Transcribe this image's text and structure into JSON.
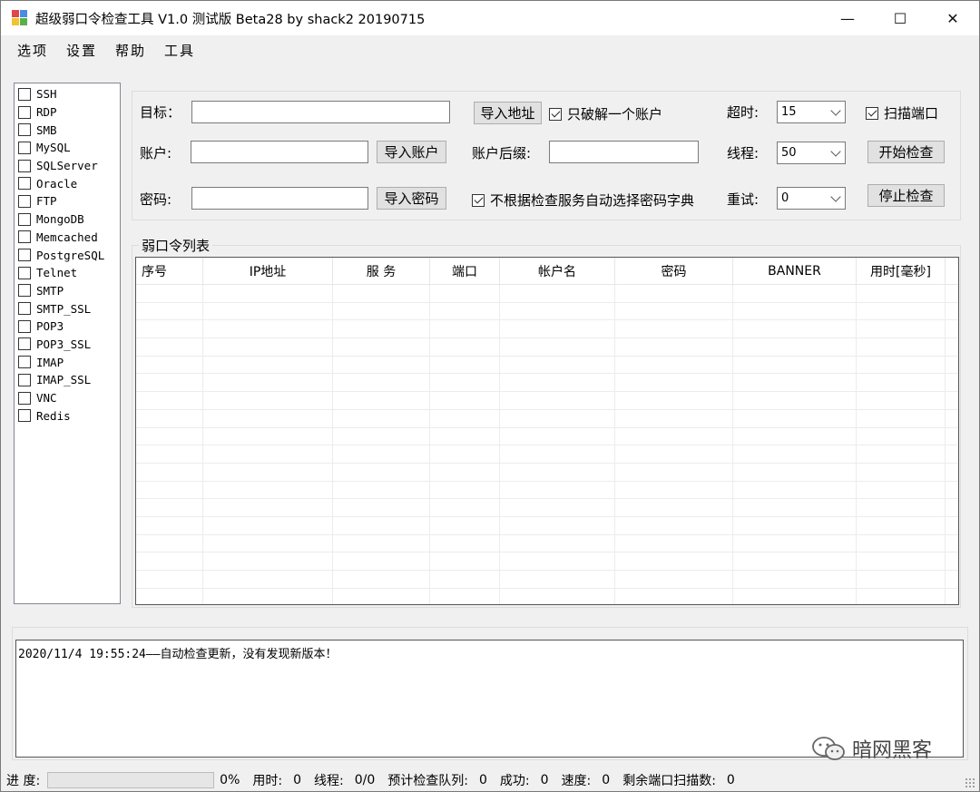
{
  "window": {
    "title": "超级弱口令检查工具 V1.0 测试版 Beta28 by shack2 20190715",
    "minimize": "—",
    "maximize": "☐",
    "close": "✕"
  },
  "menu": [
    "选项",
    "设置",
    "帮助",
    "工具"
  ],
  "services": [
    {
      "label": "SSH",
      "checked": false
    },
    {
      "label": "RDP",
      "checked": false
    },
    {
      "label": "SMB",
      "checked": false
    },
    {
      "label": "MySQL",
      "checked": false
    },
    {
      "label": "SQLServer",
      "checked": false
    },
    {
      "label": "Oracle",
      "checked": false
    },
    {
      "label": "FTP",
      "checked": false
    },
    {
      "label": "MongoDB",
      "checked": false
    },
    {
      "label": "Memcached",
      "checked": false
    },
    {
      "label": "PostgreSQL",
      "checked": false
    },
    {
      "label": "Telnet",
      "checked": false
    },
    {
      "label": "SMTP",
      "checked": false
    },
    {
      "label": "SMTP_SSL",
      "checked": false
    },
    {
      "label": "POP3",
      "checked": false
    },
    {
      "label": "POP3_SSL",
      "checked": false
    },
    {
      "label": "IMAP",
      "checked": false
    },
    {
      "label": "IMAP_SSL",
      "checked": false
    },
    {
      "label": "VNC",
      "checked": false
    },
    {
      "label": "Redis",
      "checked": false
    }
  ],
  "form": {
    "target_label": "目标：",
    "target_value": "",
    "import_address": "导入地址",
    "only_one_account_label": "只破解一个账户",
    "only_one_account_checked": true,
    "timeout_label": "超时:",
    "timeout_value": "15",
    "scan_port_label": "扫描端口",
    "scan_port_checked": true,
    "account_label": "账户:",
    "account_value": "",
    "import_account": "导入账户",
    "account_suffix_label": "账户后缀:",
    "account_suffix_value": "",
    "threads_label": "线程:",
    "threads_value": "50",
    "start_check": "开始检查",
    "password_label": "密码:",
    "password_value": "",
    "import_password": "导入密码",
    "auto_dict_label": "不根据检查服务自动选择密码字典",
    "auto_dict_checked": true,
    "retry_label": "重试:",
    "retry_value": "0",
    "stop_check": "停止检查"
  },
  "results": {
    "group_title": "弱口令列表",
    "columns": [
      "序号",
      "IP地址",
      "服 务",
      "端口",
      "帐户名",
      "密码",
      "BANNER",
      "用时[毫秒]"
    ],
    "rows": []
  },
  "log": {
    "text": "2020/11/4 19:55:24——自动检查更新，没有发现新版本！"
  },
  "watermark": {
    "text": "暗网黑客"
  },
  "status": {
    "progress_label": "进 度:",
    "progress": 0,
    "percent": "0%",
    "elapsed_label": "用时:",
    "elapsed": "0",
    "threads_label": "线程:",
    "threads": "0/0",
    "queue_label": "预计检查队列:",
    "queue": "0",
    "success_label": "成功:",
    "success": "0",
    "speed_label": "速度:",
    "speed": "0",
    "remaining_label": "剩余端口扫描数:",
    "remaining": "0"
  }
}
